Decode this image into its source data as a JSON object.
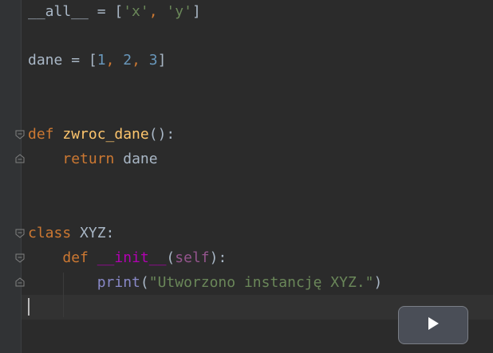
{
  "editor": {
    "language": "python",
    "lines": {
      "all_decl": {
        "name": "__all__",
        "op": " = ",
        "open": "[",
        "s1": "'x'",
        "sep": ", ",
        "s2": "'y'",
        "close": "]"
      },
      "dane_decl": {
        "name": "dane",
        "op": " = ",
        "open": "[",
        "n1": "1",
        "sep1": ", ",
        "n2": "2",
        "sep2": ", ",
        "n3": "3",
        "close": "]"
      },
      "def_line": {
        "kw": "def",
        "sp": " ",
        "fn": "zwroc_dane",
        "rest": "():"
      },
      "return_line": {
        "indent": "    ",
        "kw": "return",
        "rest": " dane"
      },
      "class_line": {
        "kw": "class",
        "rest": " XYZ:"
      },
      "init_line": {
        "indent": "    ",
        "kw": "def",
        "sp": " ",
        "fn": "__init__",
        "open": "(",
        "self": "self",
        "close": "):"
      },
      "print_line": {
        "indent": "        ",
        "builtin": "print",
        "open": "(",
        "str": "\"Utworzono instancję XYZ.\"",
        "close": ")"
      }
    }
  },
  "colors": {
    "background": "#2b2b2b",
    "keyword": "#cc7832",
    "function": "#ffc66d",
    "string": "#6a8759",
    "number": "#6897bb",
    "magic": "#b200b2",
    "self": "#94558d",
    "builtin": "#8888c6",
    "text": "#a9b7c6"
  },
  "icons": {
    "fold_open": "fold-open-icon",
    "fold_close": "fold-close-icon",
    "play": "play-icon"
  }
}
